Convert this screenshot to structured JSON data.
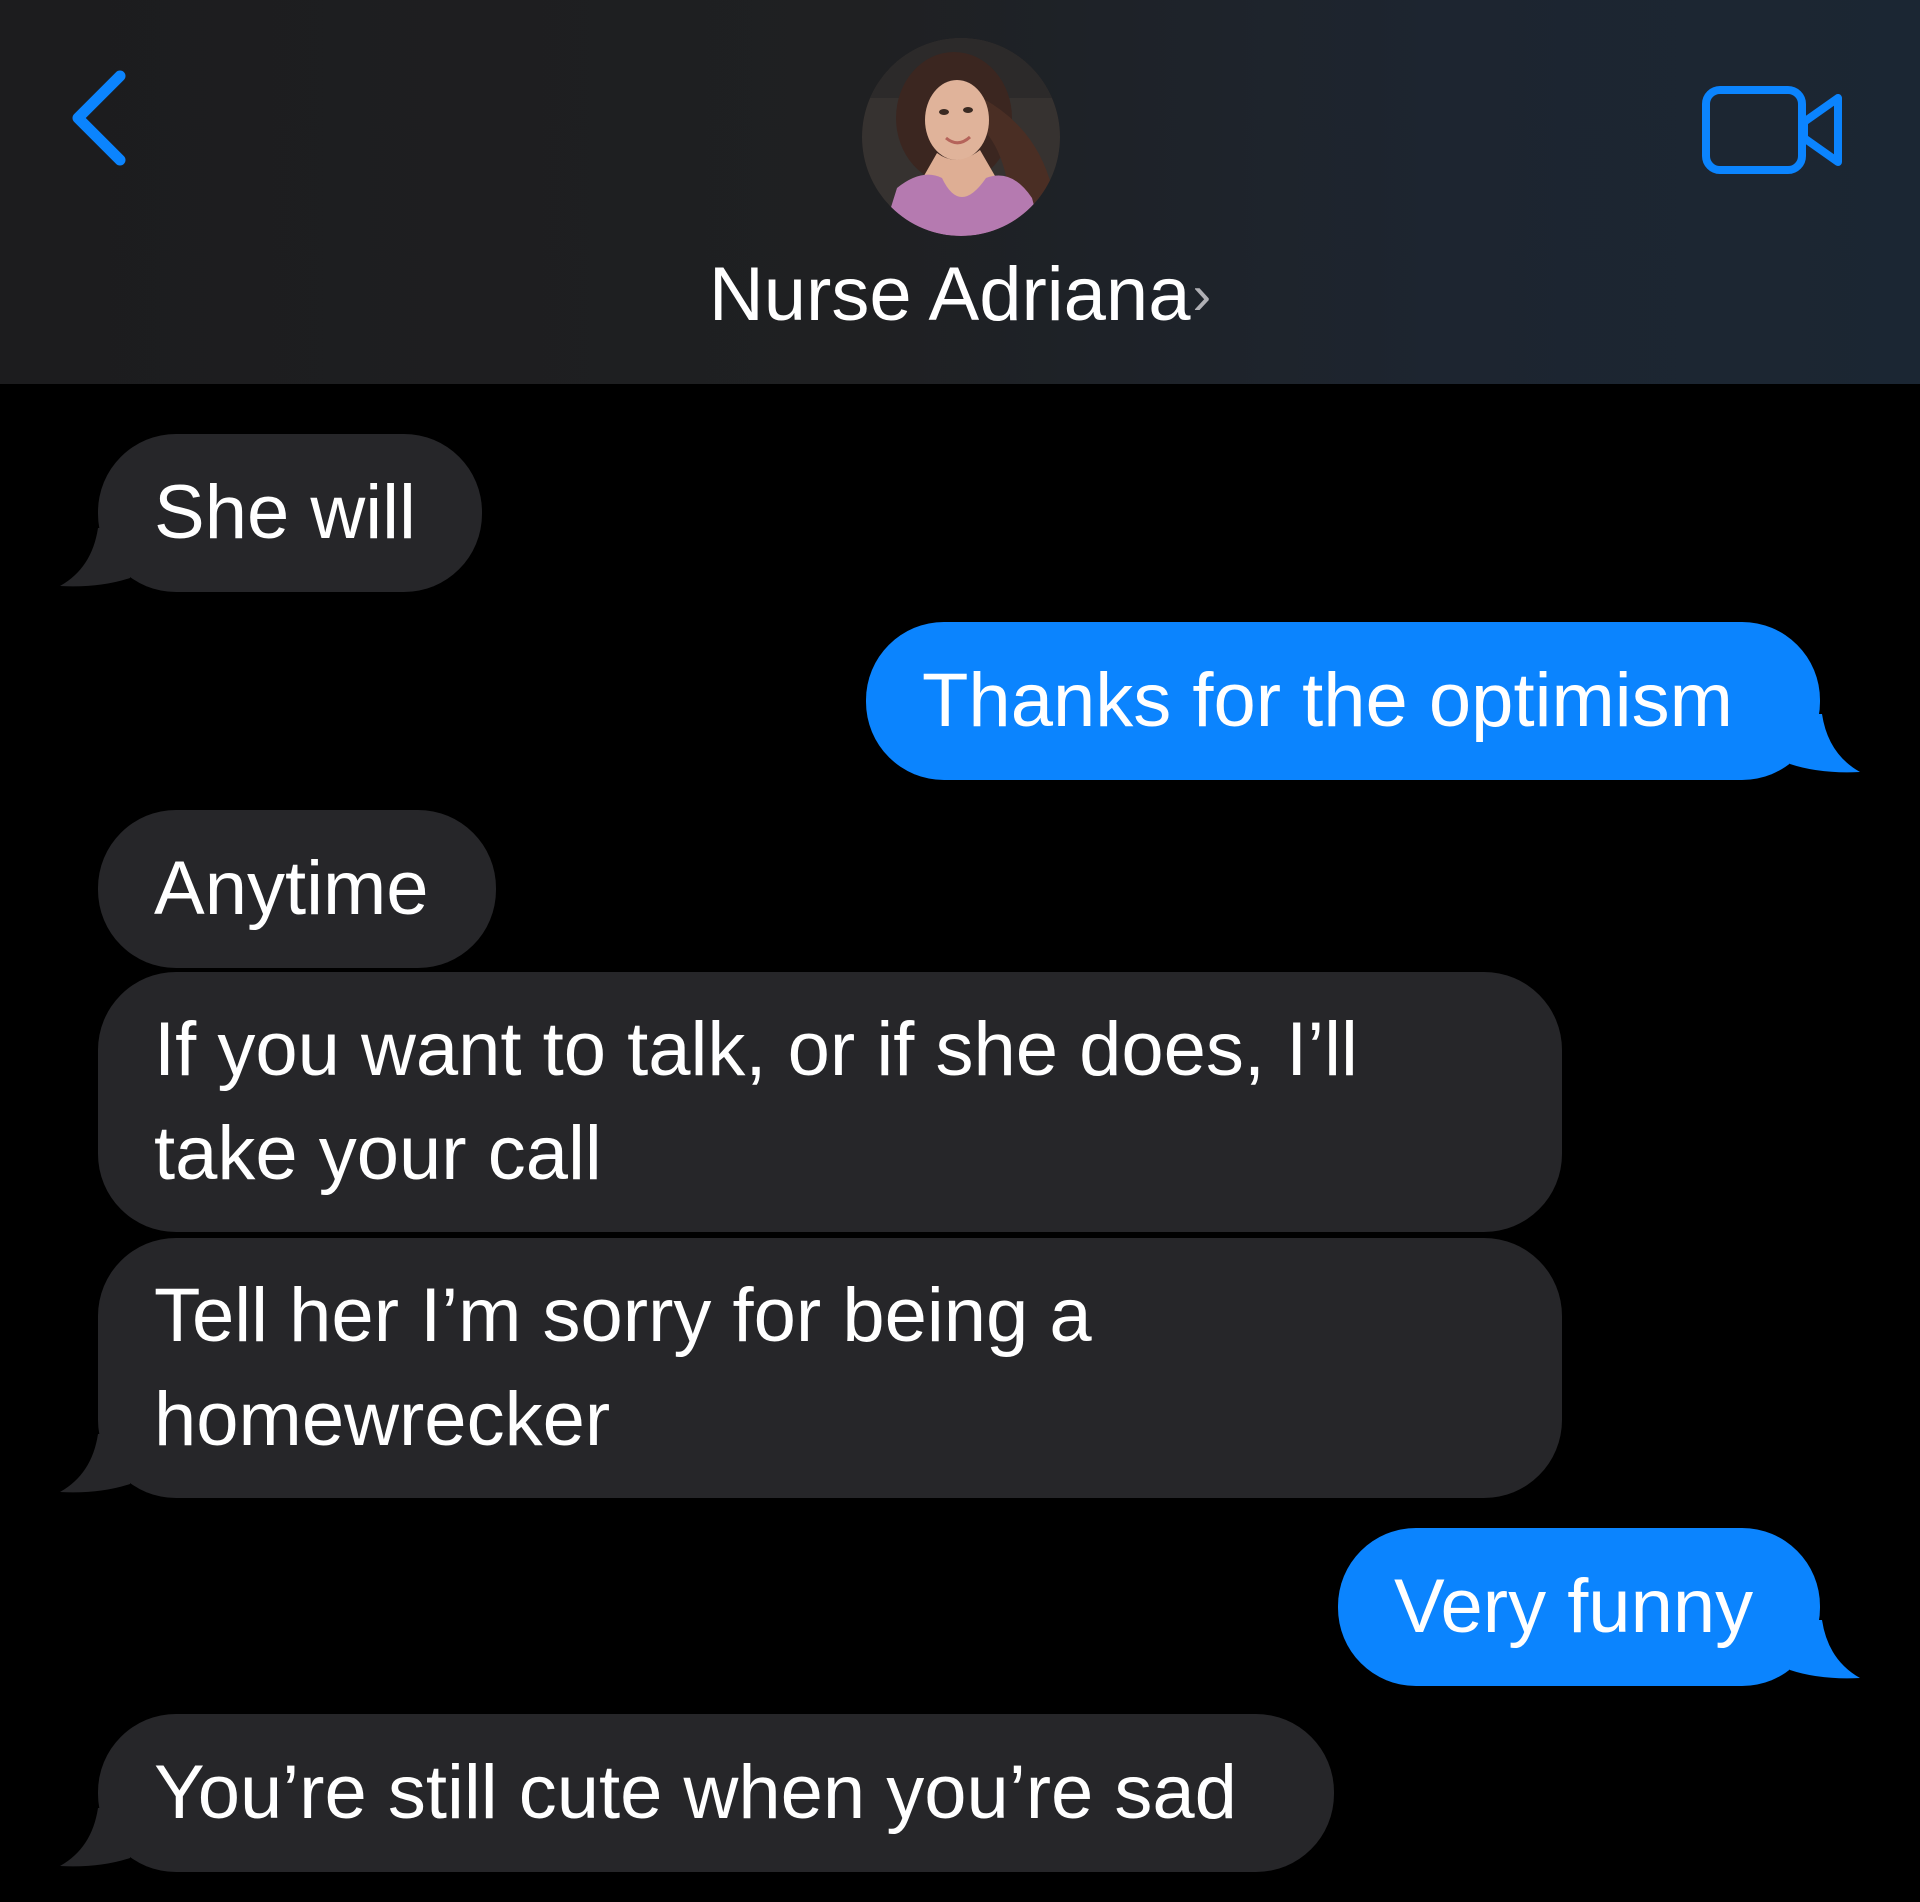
{
  "header": {
    "contact_name": "Nurse Adriana",
    "name_chevron": "›",
    "back_icon": "chevron-left-icon",
    "video_icon": "video-camera-icon",
    "accent_color": "#0b84fe"
  },
  "messages": [
    {
      "direction": "received",
      "text": "She will"
    },
    {
      "direction": "sent",
      "text": "Thanks for the optimism"
    },
    {
      "direction": "received",
      "text": "Anytime"
    },
    {
      "direction": "received",
      "text": "If you want to talk, or if she does, I’ll take your call"
    },
    {
      "direction": "received",
      "text": "Tell her I’m sorry for being a homewrecker"
    },
    {
      "direction": "sent",
      "text": "Very funny"
    },
    {
      "direction": "received",
      "text": "You’re still cute when you’re sad"
    }
  ],
  "colors": {
    "received_bubble": "#262629",
    "sent_bubble": "#0b84fe",
    "background": "#000000"
  }
}
